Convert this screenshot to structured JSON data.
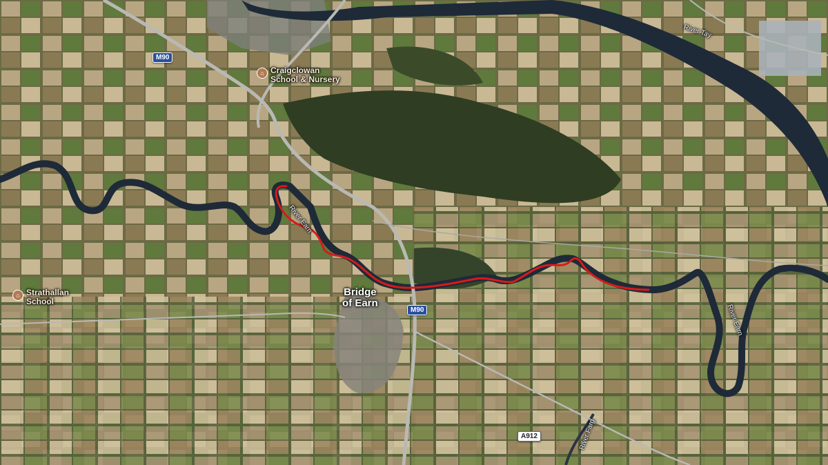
{
  "map": {
    "background": "#4d5a35",
    "highlight_color": "#d81a1a",
    "river_color": "#1e2a38",
    "road_color": "#b9b9b3"
  },
  "labels": {
    "town": [
      "Bridge",
      "of Earn"
    ],
    "schools": [
      {
        "name": [
          "Craigclowan",
          "School & Nursery"
        ],
        "icon": "school-icon"
      },
      {
        "name": [
          "Strathallan",
          "School"
        ],
        "icon": "school-icon"
      }
    ],
    "rivers": {
      "tay": "River Tay",
      "earn_route": "River Earn",
      "earn_east": "River Earn",
      "farg": "River Farg"
    },
    "roads": {
      "m90_north": "M90",
      "m90_south": "M90",
      "a912": "A912"
    }
  }
}
